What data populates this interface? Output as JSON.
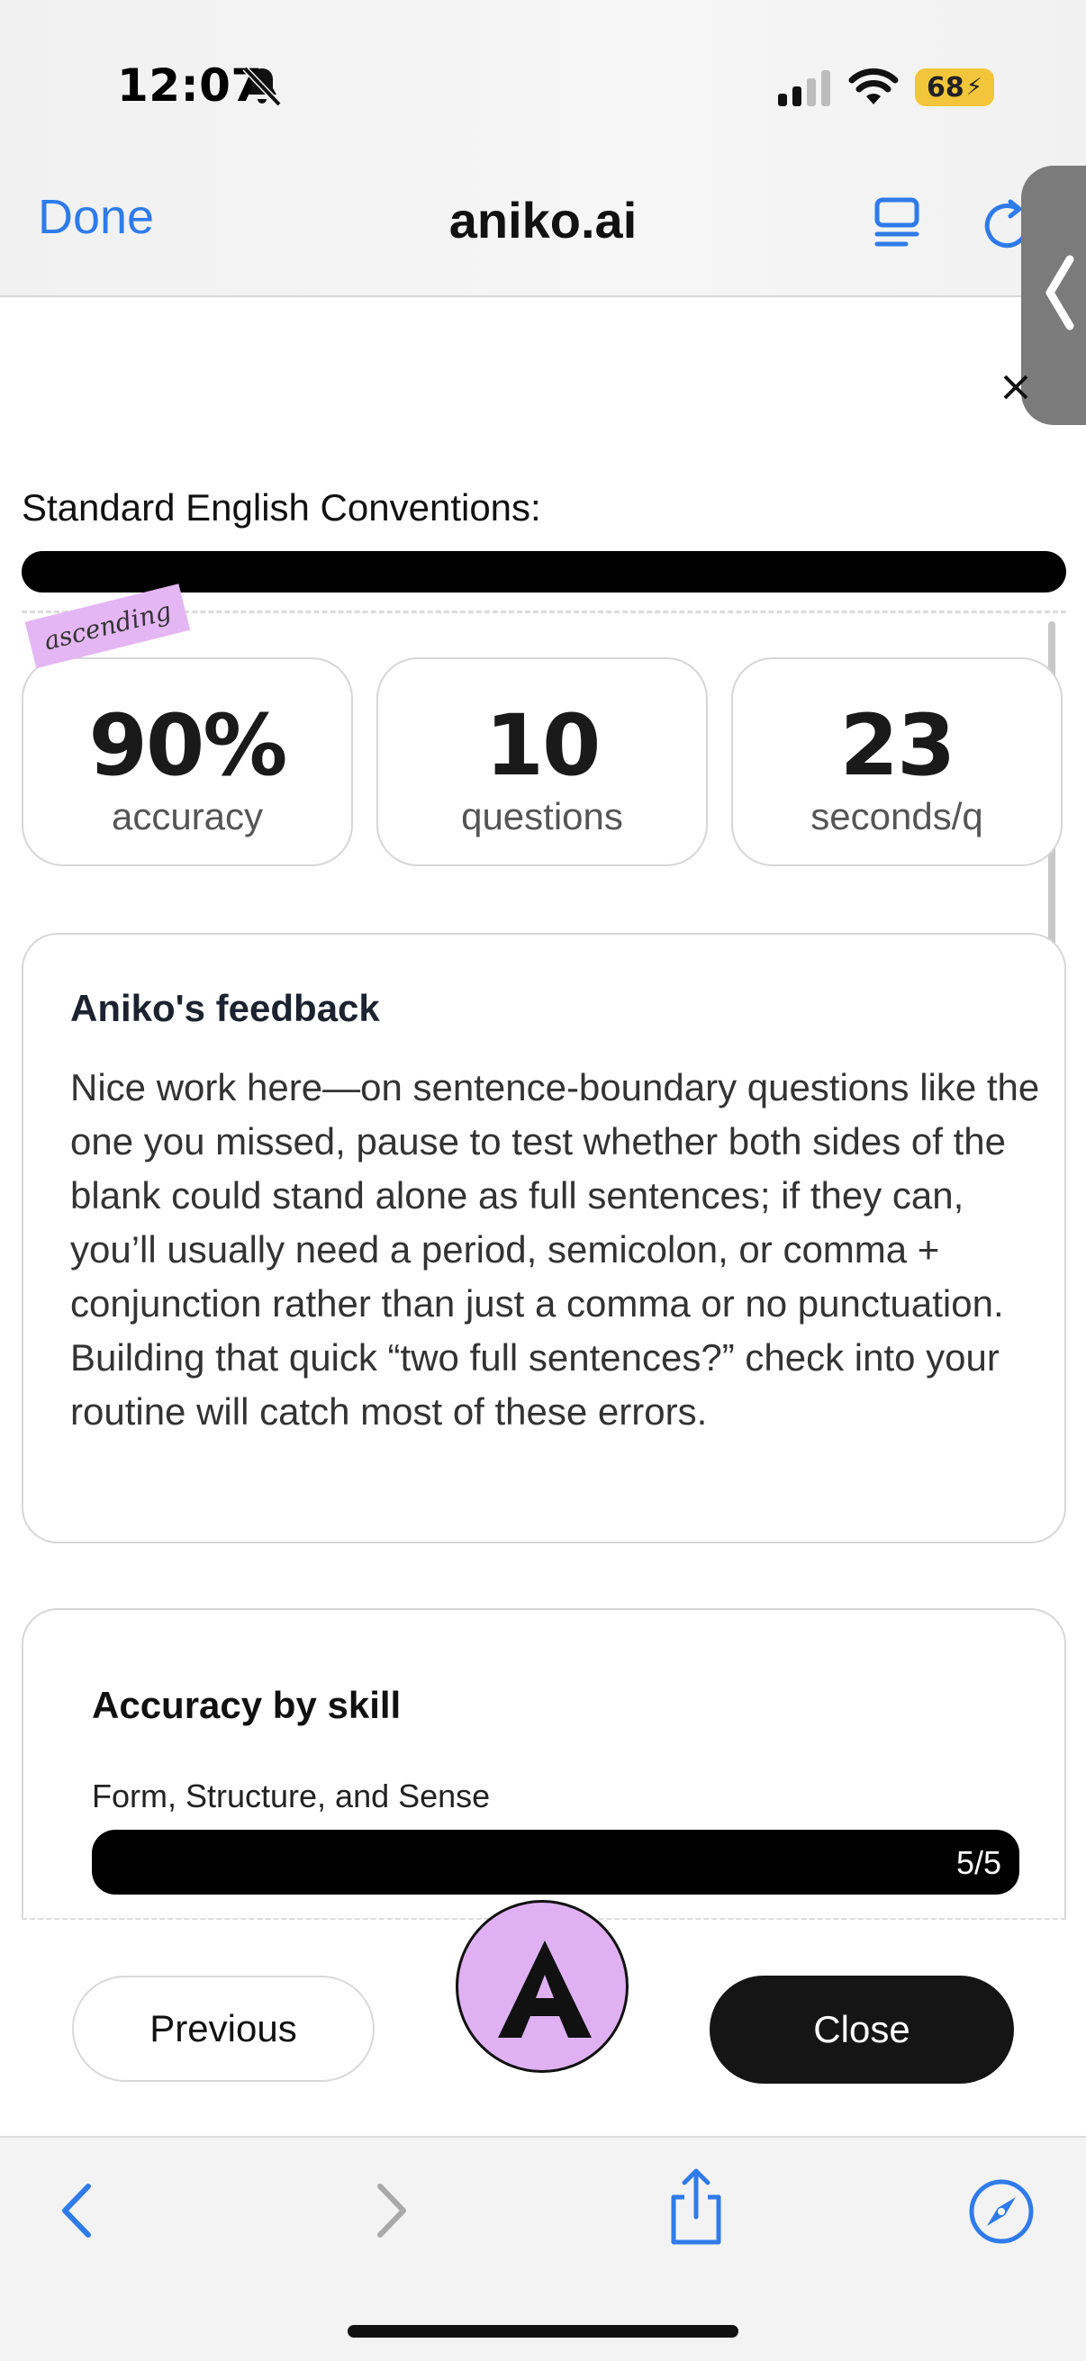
{
  "status_bar": {
    "time": "12:07",
    "battery": "68"
  },
  "browser": {
    "done_label": "Done",
    "site_title": "aniko.ai"
  },
  "section": {
    "title": "Standard English Conventions:"
  },
  "badge": {
    "text": "ascending"
  },
  "stats": [
    {
      "value": "90%",
      "label": "accuracy"
    },
    {
      "value": "10",
      "label": "questions"
    },
    {
      "value": "23",
      "label": "seconds/q"
    }
  ],
  "feedback": {
    "title": "Aniko's feedback",
    "body": "Nice work here—on sentence-boundary questions like the one you missed, pause to test whether both sides of the blank could stand alone as full sentences; if they can, you’ll usually need a period, semicolon, or comma + conjunction rather than just a comma or no punctuation. Building that quick “two full sentences?” check into your routine will catch most of these errors."
  },
  "skills": {
    "title": "Accuracy by skill",
    "items": [
      {
        "name": "Form, Structure, and Sense",
        "score": "5/5",
        "fraction": 1.0
      }
    ]
  },
  "footer": {
    "previous_label": "Previous",
    "close_label": "Close"
  },
  "colors": {
    "accent_blue": "#2f7bea",
    "badge_purple": "#e4b6f3",
    "avatar_purple": "#dfb1f3",
    "dark_button": "#151515"
  },
  "icons": [
    "bell-off-icon",
    "signal-icon",
    "wifi-icon",
    "reader-icon",
    "reload-icon",
    "chevron-left-icon",
    "close-icon",
    "back-icon",
    "forward-icon",
    "share-icon",
    "compass-icon"
  ]
}
